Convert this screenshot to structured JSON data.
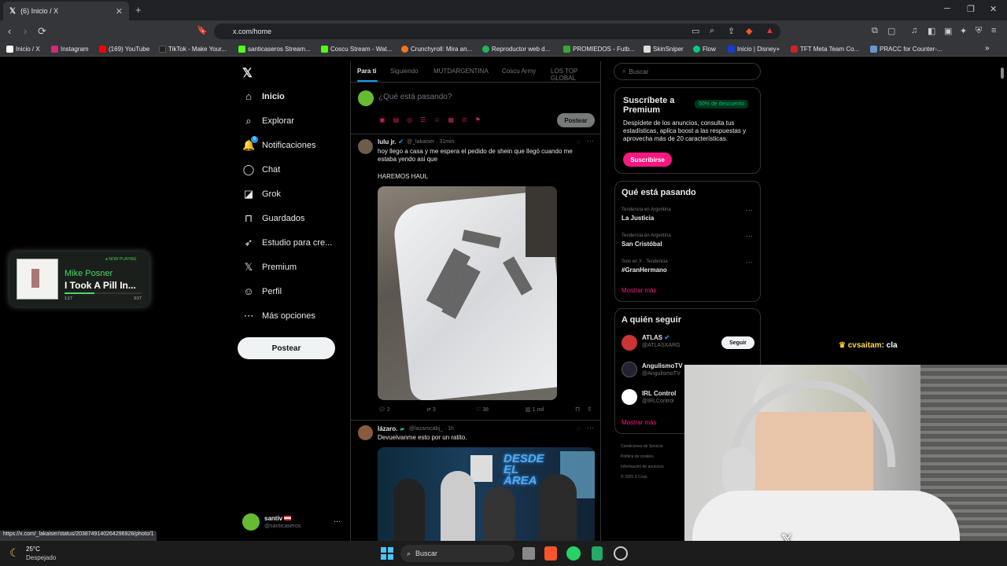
{
  "browser": {
    "tab_title": "(6) Inicio / X",
    "url": "x.com/home",
    "bookmarks": [
      "Inicio / X",
      "Instagram",
      "(169) YouTube",
      "TikTok - Make Your...",
      "santicaseros Stream...",
      "Coscu Stream - Wat...",
      "Crunchyroll: Mira an...",
      "Reproductor web d...",
      "PROMIEDOS - Futb...",
      "SkinSniper",
      "Flow",
      "Inicio | Disney+",
      "TFT Meta Team Co...",
      "PRACC for Counter-..."
    ]
  },
  "sidebar": {
    "items": [
      {
        "label": "Inicio",
        "icon": "home-icon"
      },
      {
        "label": "Explorar",
        "icon": "search-icon"
      },
      {
        "label": "Notificaciones",
        "icon": "bell-icon",
        "badge": "6"
      },
      {
        "label": "Chat",
        "icon": "chat-icon"
      },
      {
        "label": "Grok",
        "icon": "grok-icon"
      },
      {
        "label": "Guardados",
        "icon": "bookmark-icon"
      },
      {
        "label": "Estudio para cre...",
        "icon": "rocket-icon"
      },
      {
        "label": "Premium",
        "icon": "x-icon"
      },
      {
        "label": "Perfil",
        "icon": "person-icon"
      },
      {
        "label": "Más opciones",
        "icon": "more-icon"
      }
    ],
    "post_label": "Postear",
    "account_name": "santiv",
    "account_handle": "@santicaseros"
  },
  "feed": {
    "tabs": [
      "Para ti",
      "Siguiendo",
      "MUTDARGENTINA",
      "Coscu Army",
      "LOS TOP GLOBAL"
    ],
    "composer_placeholder": "¿Qué está pasando?",
    "composer_post": "Postear",
    "tweets": [
      {
        "name": "lulu jr.",
        "handle": "@_lakaiser",
        "time": "· 31min",
        "text": "hoy llego a casa y me espera el pedido de shein que llegó cuando me estaba yendo asi que",
        "text2": "HAREMOS HAUL",
        "replies": "2",
        "retweets": "3",
        "likes": "38",
        "views": "1 mil"
      },
      {
        "name": "lázaro.",
        "handle": "@lazarocabj_",
        "time": "· 1h",
        "text": "Devuelvanme esto por un ratito.",
        "image_text": "DESDE EL ÁREA"
      }
    ]
  },
  "right": {
    "search_placeholder": "Buscar",
    "premium": {
      "title": "Suscríbete a Premium",
      "badge": "50% de descuento",
      "desc": "Despídete de los anuncios, consulta tus estadísticas, aplica boost a las respuestas y aprovecha más de 20 características.",
      "button": "Suscribirse"
    },
    "trends_title": "Qué está pasando",
    "trends": [
      {
        "context": "Tendencia en Argentina",
        "name": "La Justicia"
      },
      {
        "context": "Tendencia en Argentina",
        "name": "San Cristóbal"
      },
      {
        "context": "Solo en X · Tendencia",
        "name": "#GranHermano"
      }
    ],
    "show_more": "Mostrar más",
    "follow_title": "A quién seguir",
    "follow": [
      {
        "name": "ATLAS",
        "handle": "@ATLASXARG",
        "button": "Seguir"
      },
      {
        "name": "AngulismoTV",
        "handle": "@AngulismoTV"
      },
      {
        "name": "IRL Control",
        "handle": "@IRLControl"
      }
    ],
    "follow_more": "Mostrar más",
    "footer": [
      "Condiciones de Servicio",
      "Política de cookies",
      "Información de anuncios",
      "© 2025 X Corp."
    ]
  },
  "overlay": {
    "now_playing": "● NOW PLAYING",
    "artist": "Mike Posner",
    "song": "I Took A Pill In...",
    "time_start": "1:17",
    "time_end": "3:17",
    "chat_user": "cvsaitam",
    "chat_msg": ": cla"
  },
  "statusbar_url": "https://x.com/_lakaiser/status/2038749140264296928/photo/1",
  "taskbar": {
    "temp": "25°C",
    "weather": "Despejado",
    "search": "Buscar"
  }
}
